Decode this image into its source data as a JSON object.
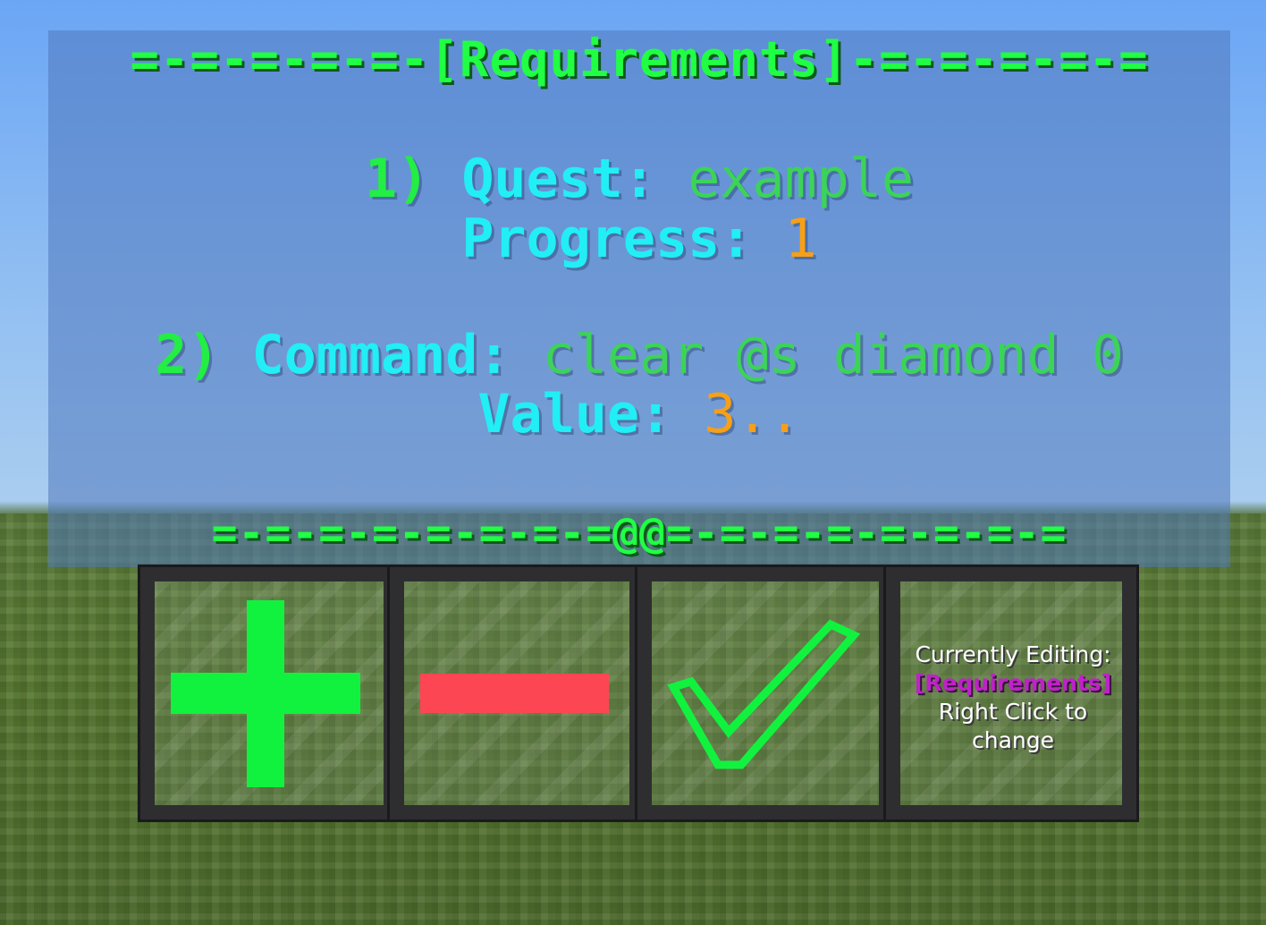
{
  "header": {
    "divider": "=-=-=-=-=-[Requirements]-=-=-=-=-="
  },
  "requirements": [
    {
      "number": "1)",
      "type_label": "Quest:",
      "type_value": "example",
      "stat_label": "Progress:",
      "stat_value": "1"
    },
    {
      "number": "2)",
      "type_label": "Command:",
      "type_value": "clear @s diamond 0",
      "stat_label": "Value:",
      "stat_value": "3.."
    }
  ],
  "footer": {
    "divider": "=-=-=-=-=-=-=-=@@=-=-=-=-=-=-=-="
  },
  "buttons": [
    {
      "name": "add",
      "icon": "plus-icon",
      "color": "#11f23f"
    },
    {
      "name": "remove",
      "icon": "minus-icon",
      "color": "#fd4653"
    },
    {
      "name": "confirm",
      "icon": "checkmark-icon",
      "color": "#11f23f"
    }
  ],
  "info": {
    "line1": "Currently Editing:",
    "line2": "[Requirements]",
    "line3": "Right Click to",
    "line4": "change"
  },
  "colors": {
    "number": "#22ee44",
    "label": "#22eef5",
    "value": "#3bd458",
    "stat": "#f7a017",
    "highlight": "#bf22c8"
  }
}
